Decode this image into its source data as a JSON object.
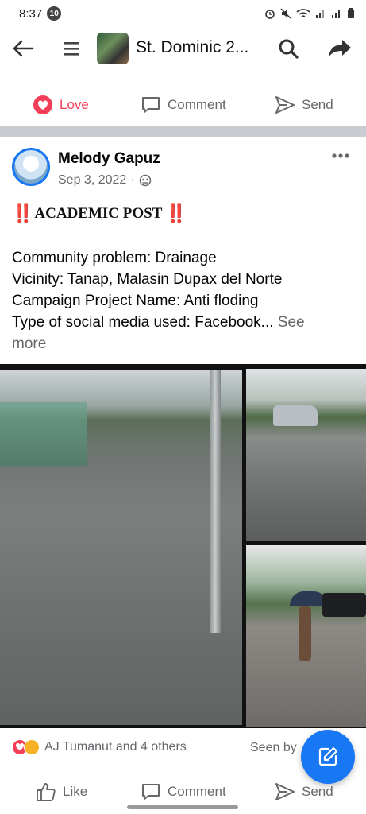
{
  "status_bar": {
    "time": "8:37",
    "notification_count": "10",
    "icons": [
      "alarm-icon",
      "mute-icon",
      "wifi-icon",
      "signal-icon",
      "signal-icon",
      "battery-icon"
    ]
  },
  "app_bar": {
    "title": "St. Dominic 2...",
    "icons": [
      "back-arrow-icon",
      "menu-icon",
      "search-icon",
      "share-icon"
    ]
  },
  "previous_post_actions": {
    "love_label": "Love",
    "comment_label": "Comment",
    "send_label": "Send"
  },
  "post": {
    "author": "Melody Gapuz",
    "date": "Sep 3, 2022",
    "separator": "·",
    "privacy_icon": "group-members-icon",
    "title_marker": "‼️",
    "title": "ACADEMIC POST",
    "body_lines": [
      "Community problem: Drainage",
      "Vicinity: Tanap, Malasin Dupax del Norte",
      "Campaign Project Name: Anti floding",
      "Type of social media used: Facebook..."
    ],
    "see_more": "See",
    "see_more_2": "more",
    "reactions_text": "AJ Tumanut and 4 others",
    "seen_by": "Seen by",
    "actions": {
      "like_label": "Like",
      "comment_label": "Comment",
      "send_label": "Send"
    }
  },
  "colors": {
    "brand_blue": "#1877f2",
    "love_red": "#f33e58",
    "alert_red": "#e02424",
    "secondary_text": "#65676b",
    "divider": "#c9ccd1"
  }
}
